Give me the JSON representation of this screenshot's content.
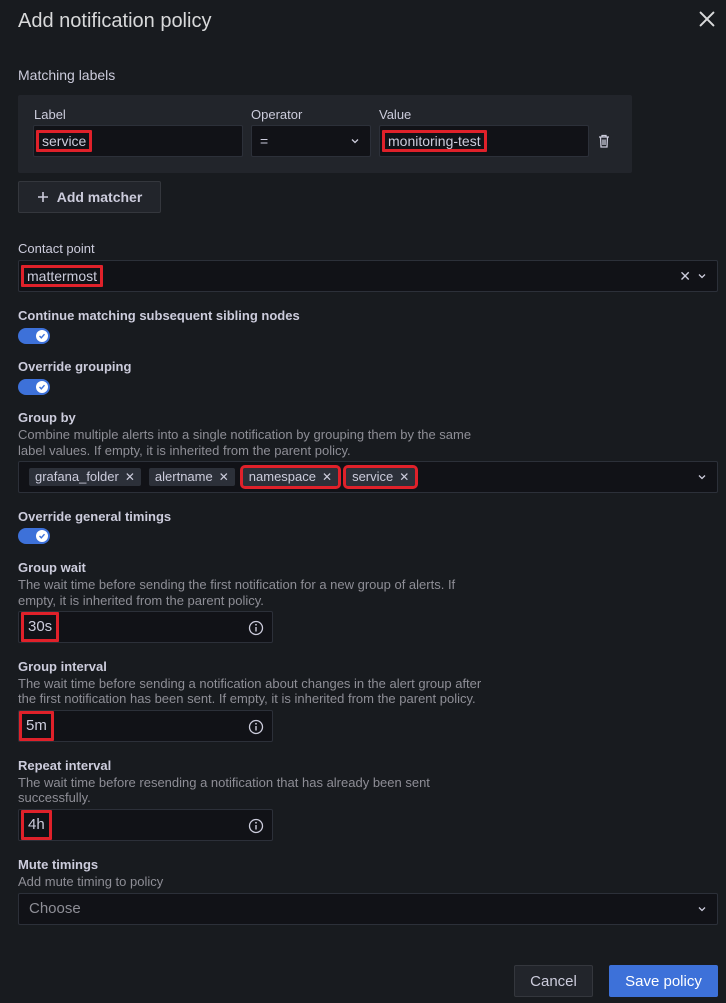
{
  "modal": {
    "title": "Add notification policy",
    "close_icon": "close-icon"
  },
  "matchers": {
    "section_label": "Matching labels",
    "col_label": "Label",
    "col_operator": "Operator",
    "col_value": "Value",
    "label_value": "service",
    "operator_value": "=",
    "value_value": "monitoring-test",
    "add_matcher_label": "Add matcher"
  },
  "contact_point": {
    "label": "Contact point",
    "value": "mattermost"
  },
  "continue_matching": {
    "label": "Continue matching subsequent sibling nodes",
    "enabled": true
  },
  "override_grouping": {
    "label": "Override grouping",
    "enabled": true
  },
  "group_by": {
    "label": "Group by",
    "description_line1": "Combine multiple alerts into a single notification by grouping them by the same",
    "description_line2": "label values. If empty, it is inherited from the parent policy.",
    "tags": [
      "grafana_folder",
      "alertname",
      "namespace",
      "service"
    ]
  },
  "override_timings": {
    "label": "Override general timings",
    "enabled": true
  },
  "group_wait": {
    "label": "Group wait",
    "description_line1": "The wait time before sending the first notification for a new group of alerts. If",
    "description_line2": "empty, it is inherited from the parent policy.",
    "value": "30s"
  },
  "group_interval": {
    "label": "Group interval",
    "description_line1": "The wait time before sending a notification about changes in the alert group after",
    "description_line2": "the first notification has been sent. If empty, it is inherited from the parent policy.",
    "value": "5m"
  },
  "repeat_interval": {
    "label": "Repeat interval",
    "description_line1": "The wait time before resending a notification that has already been sent",
    "description_line2": "successfully.",
    "value": "4h"
  },
  "mute_timings": {
    "label": "Mute timings",
    "description": "Add mute timing to policy",
    "placeholder": "Choose"
  },
  "footer": {
    "cancel_label": "Cancel",
    "save_label": "Save policy"
  },
  "colors": {
    "background": "#181b1f",
    "primary": "#3d71d9",
    "highlight": "#e0212a"
  }
}
